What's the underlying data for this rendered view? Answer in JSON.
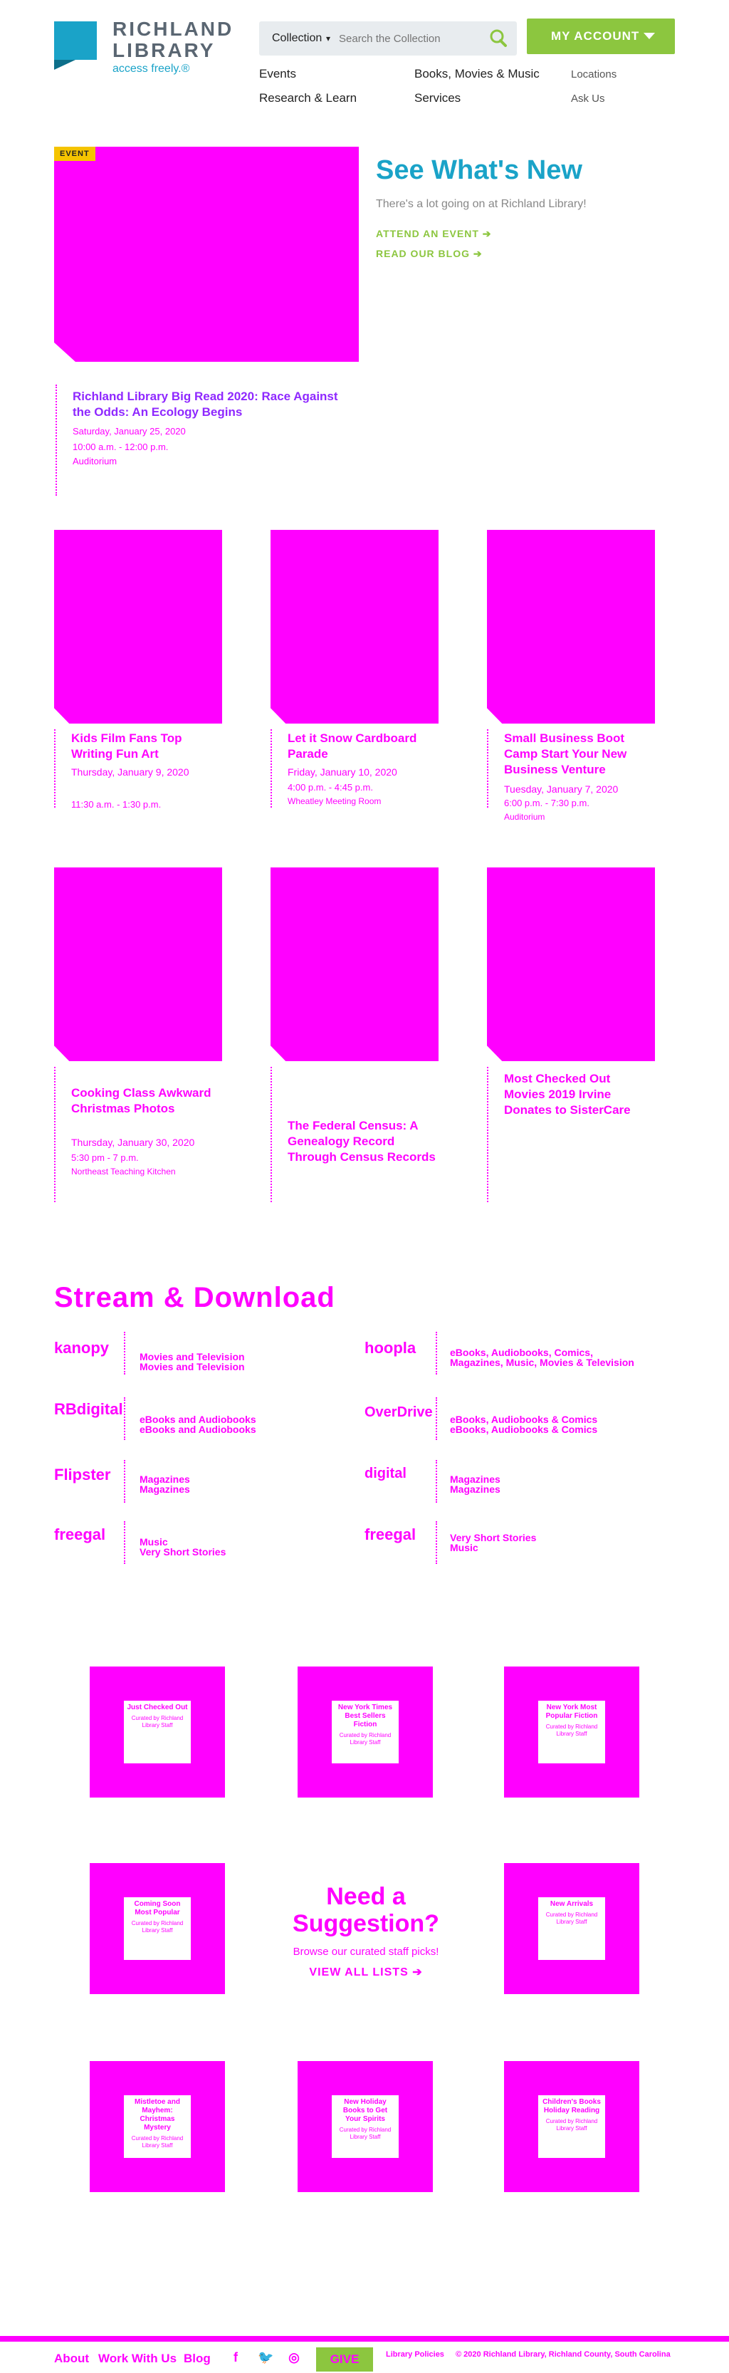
{
  "header": {
    "logo_name_1": "RICHLAND",
    "logo_name_2": "LIBRARY",
    "tagline": "access freely.®",
    "search_scope": "Collection",
    "search_placeholder": "Search the Collection",
    "account_label": "MY ACCOUNT",
    "nav": [
      "Events",
      "Books, Movies & Music",
      "Research & Learn",
      "Services"
    ],
    "util": [
      "Locations",
      "Ask Us"
    ]
  },
  "featured": {
    "tag": "EVENT",
    "title": "Richland Library Big Read 2020: Race Against the Odds: An Ecology Begins",
    "date": "Saturday, January 25, 2020",
    "time": "10:00 a.m. - 12:00 p.m.",
    "room": "Auditorium"
  },
  "whats_new": {
    "title": "See What's New",
    "subtitle": "There's a lot going on at Richland Library!",
    "link1": "ATTEND AN EVENT ➔",
    "link2": "READ OUR BLOG ➔"
  },
  "events": [
    {
      "title": "Kids Film Fans Top Writing Fun Art",
      "date": "Thursday, January 9, 2020",
      "time": "11:30 a.m. - 1:30 p.m.",
      "room": ""
    },
    {
      "title": "Let it Snow Cardboard Parade",
      "date": "Friday, January 10, 2020",
      "time": "4:00 p.m. - 4:45 p.m.",
      "room": "Wheatley Meeting Room"
    },
    {
      "title": "Small Business Boot Camp Start Your New Business Venture",
      "date": "Tuesday, January 7, 2020",
      "time": "6:00 p.m. - 7:30 p.m.",
      "room": "Auditorium"
    },
    {
      "title": "Cooking Class Awkward Christmas Photos",
      "date": "Thursday, January 30, 2020",
      "time": "5:30 pm - 7 p.m.",
      "room": "Northeast Teaching Kitchen"
    },
    {
      "title": "The Federal Census: A Genealogy Record Through Census Records",
      "date": "",
      "time": "",
      "room": ""
    },
    {
      "title": "Most Checked Out Movies 2019 Irvine Donates to SisterCare",
      "date": "",
      "time": "",
      "room": ""
    }
  ],
  "stream": {
    "title": "Stream & Download",
    "services": [
      {
        "logo": "kanopy",
        "text1": "Movies and Television",
        "text2": "Movies and Television"
      },
      {
        "logo": "hoopla",
        "text1": "eBooks, Audiobooks, Comics,",
        "text2": "Magazines, Music, Movies & Television"
      },
      {
        "logo": "RBdigital",
        "text1": "eBooks and Audiobooks",
        "text2": "eBooks and Audiobooks"
      },
      {
        "logo": "OverDrive",
        "text1": "eBooks, Audiobooks & Comics",
        "text2": "eBooks, Audiobooks & Comics"
      },
      {
        "logo": "Flipster",
        "text1": "Magazines",
        "text2": "Magazines"
      },
      {
        "logo": "digital",
        "text1": "Magazines",
        "text2": "Magazines"
      },
      {
        "logo": "freegal",
        "text1": "Music",
        "text2": "Very Short Stories"
      },
      {
        "logo": "freegal",
        "text1": "Very Short Stories",
        "text2": "Music"
      }
    ]
  },
  "lists": [
    {
      "title": "Just Checked Out",
      "curator": "Curated by Richland Library Staff"
    },
    {
      "title": "New York Times Best Sellers Fiction",
      "curator": "Curated by Richland Library Staff"
    },
    {
      "title": "New York Most Popular Fiction",
      "curator": "Curated by Richland Library Staff"
    },
    {
      "title": "Coming Soon Most Popular",
      "curator": "Curated by Richland Library Staff"
    },
    {
      "title": "New Arrivals",
      "curator": "Curated by Richland Library Staff"
    },
    {
      "title": "Mistletoe and Mayhem: Christmas Mystery",
      "curator": "Curated by Richland Library Staff"
    },
    {
      "title": "New Holiday Books to Get Your Spirits",
      "curator": "Curated by Richland Library Staff"
    },
    {
      "title": "Children's Books Holiday Reading",
      "curator": "Curated by Richland Library Staff"
    }
  ],
  "suggest": {
    "title": "Need a Suggestion?",
    "subtitle": "Browse our curated staff picks!",
    "link": "VIEW ALL LISTS ➔"
  },
  "footer": {
    "links": [
      "About",
      "Work With Us",
      "Blog"
    ],
    "give": "GIVE",
    "policies": "Library Policies",
    "copyright": "© 2020 Richland Library, Richland County, South Carolina"
  },
  "colors": {
    "brand_blue": "#1aa3c8",
    "brand_green": "#8cc63f",
    "placeholder_magenta": "#ff00ff"
  }
}
